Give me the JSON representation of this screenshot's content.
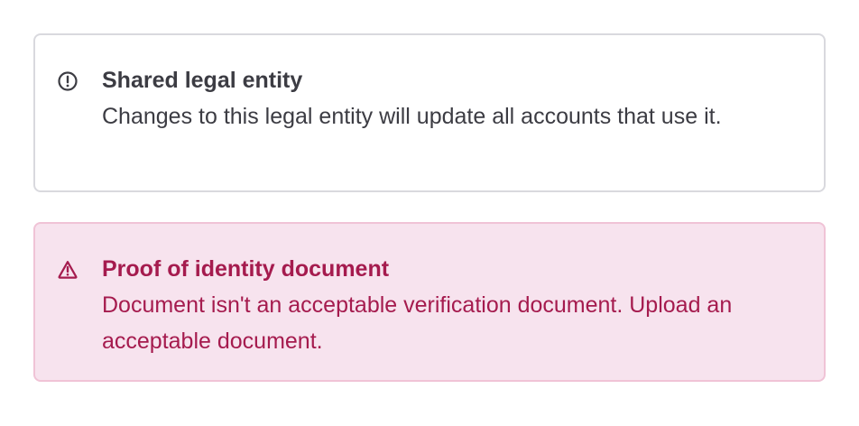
{
  "colors": {
    "info_text": "#3c3c43",
    "info_border": "#d9d9de",
    "error_text": "#a51b4e",
    "error_background": "#f7e3ee",
    "error_border": "#f0c3d6"
  },
  "banners": [
    {
      "type": "info",
      "icon": "exclamation-circle-icon",
      "title": "Shared legal entity",
      "description": "Changes to this legal entity will update all accounts that use it."
    },
    {
      "type": "error",
      "icon": "warning-triangle-icon",
      "title": "Proof of identity document",
      "description": "Document isn't an acceptable verification document. Upload an acceptable document."
    }
  ]
}
